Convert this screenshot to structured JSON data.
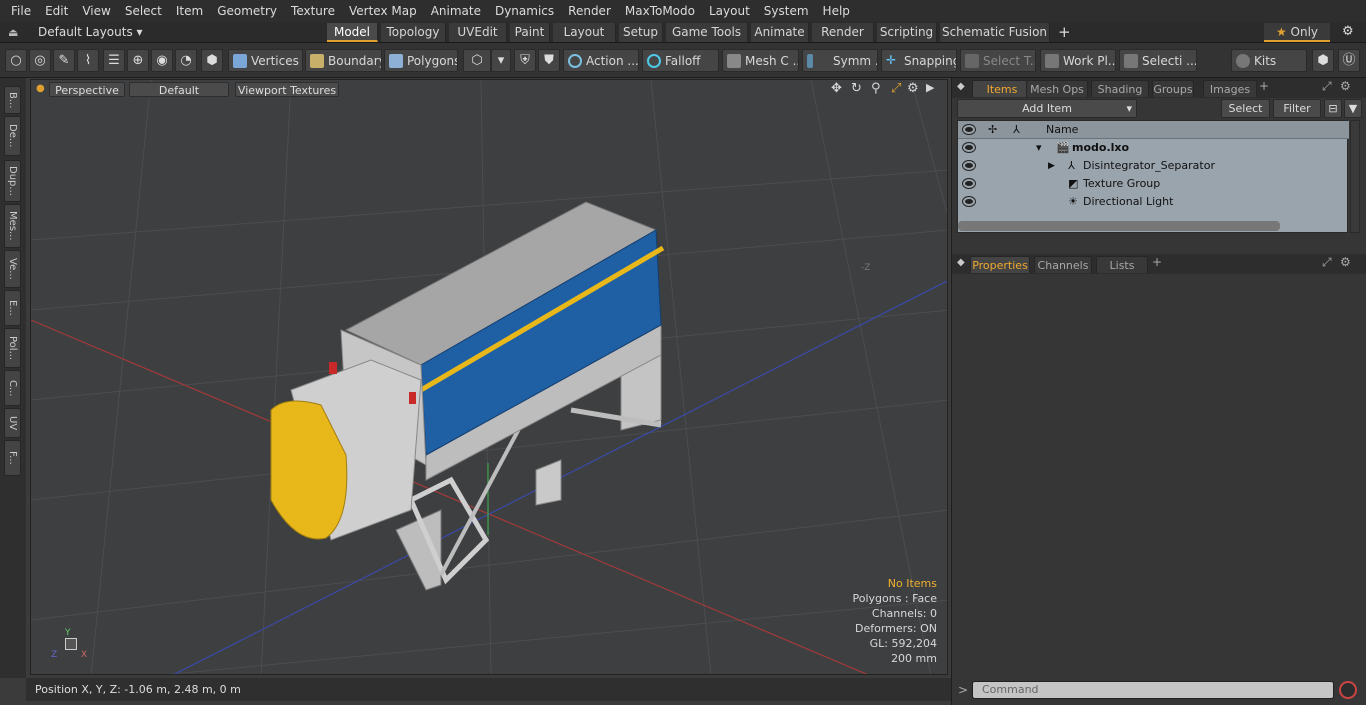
{
  "menu": [
    "File",
    "Edit",
    "View",
    "Select",
    "Item",
    "Geometry",
    "Texture",
    "Vertex Map",
    "Animate",
    "Dynamics",
    "Render",
    "MaxToModo",
    "Layout",
    "System",
    "Help"
  ],
  "layout_dropdown": "Default Layouts",
  "layout_tabs": [
    "Model",
    "Topology",
    "UVEdit",
    "Paint",
    "Layout",
    "Setup",
    "Game Tools",
    "Animate",
    "Render",
    "Scripting",
    "Schematic Fusion"
  ],
  "only_label": "Only",
  "toolbar": {
    "vertices": "Vertices",
    "boundary": "Boundary",
    "polygons": "Polygons",
    "action": "Action",
    "falloff": "Falloff",
    "mesh": "Mesh C ...",
    "symm": "Symm ...",
    "snapping": "Snapping",
    "select_t": "Select T...",
    "work": "Work Pl...",
    "selecti": "Selecti ...",
    "kits": "Kits"
  },
  "left_tabs": [
    "B...",
    "De...",
    "Dup...",
    "Mes...",
    "Ve...",
    "E...",
    "Pol...",
    "C...",
    "UV",
    "F..."
  ],
  "viewport": {
    "perspective": "Perspective",
    "default": "Default",
    "textures": "Viewport Textures",
    "axis_label": "-Z"
  },
  "vp_info": {
    "items": "No Items",
    "polygons": "Polygons : Face",
    "channels": "Channels: 0",
    "deformers": "Deformers: ON",
    "gl": "GL: 592,204",
    "scale": "200 mm"
  },
  "status": {
    "position": "Position X, Y, Z:   -1.06 m, 2.48 m, 0 m"
  },
  "items_panel": {
    "tabs": [
      "Items",
      "Mesh Ops",
      "Shading",
      "Groups",
      "Images"
    ],
    "add_item": "Add Item",
    "select": "Select",
    "filter": "Filter",
    "name_header": "Name",
    "rows": [
      "modo.lxo",
      "Disintegrator_Separator",
      "Texture Group",
      "Directional Light"
    ]
  },
  "props_panel": {
    "tabs": [
      "Properties",
      "Channels",
      "Lists"
    ]
  },
  "command": {
    "placeholder": "Command"
  },
  "colors": {
    "accent": "#e0a030",
    "machine_yellow": "#e8b81a",
    "machine_blue": "#1f5fa3"
  }
}
